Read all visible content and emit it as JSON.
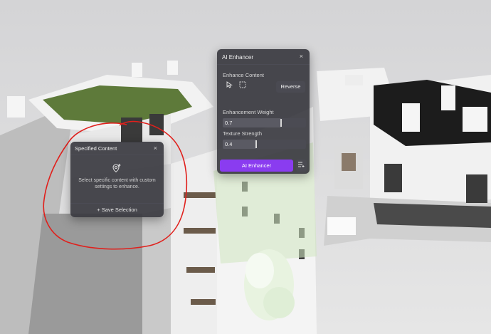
{
  "ai_enhancer": {
    "title": "AI Enhancer",
    "close_glyph": "×",
    "section_label": "Enhance Content",
    "select_tool_icon": "pointer-icon",
    "marquee_tool_icon": "marquee-icon",
    "reverse_label": "Reverse",
    "weight_label": "Enhancement Weight",
    "weight_value": "0.7",
    "weight_level": 0.7,
    "strength_label": "Texture Strength",
    "strength_value": "0.4",
    "strength_level": 0.4,
    "enhance_button_label": "AI Enhancer",
    "menu_icon": "settings-list-icon",
    "accent_color": "#8a3cf0"
  },
  "specified_content": {
    "title": "Specified Content",
    "close_glyph": "×",
    "icon": "pin-add-icon",
    "description": "Select specific content with custom settings to enhance.",
    "save_label": "+ Save Selection"
  },
  "annotation": {
    "color": "#e0201c"
  }
}
